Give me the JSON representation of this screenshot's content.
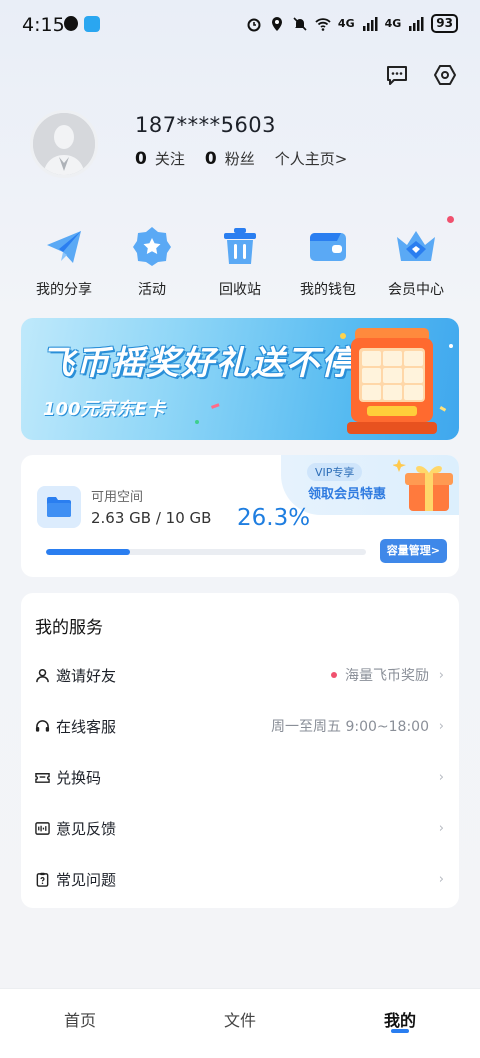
{
  "status_bar": {
    "time": "4:15",
    "battery": "93",
    "net1": "4G",
    "net2": "4G"
  },
  "header": {
    "message_icon": "message-icon",
    "settings_icon": "settings-hex-icon"
  },
  "profile": {
    "username": "187****5603",
    "following_count": "0",
    "following_label": "关注",
    "followers_count": "0",
    "followers_label": "粉丝",
    "home_link": "个人主页>"
  },
  "quick_actions": [
    {
      "label": "我的分享",
      "icon": "paper-plane-icon"
    },
    {
      "label": "活动",
      "icon": "star-badge-icon"
    },
    {
      "label": "回收站",
      "icon": "trash-icon"
    },
    {
      "label": "我的钱包",
      "icon": "wallet-icon"
    },
    {
      "label": "会员中心",
      "icon": "crown-icon"
    }
  ],
  "banner": {
    "title": "飞币摇奖好礼送不停",
    "subtitle": "100元京东E卡"
  },
  "storage": {
    "label": "可用空间",
    "used": "2.63 GB / 10 GB",
    "percent_text": "26.3%",
    "percent": 26.3,
    "vip_tag": "VIP专享",
    "vip_text": "领取会员特惠",
    "manage_button": "容量管理>"
  },
  "services": {
    "title": "我的服务",
    "items": [
      {
        "label": "邀请好友",
        "value": "海量飞币奖励",
        "icon": "user-icon",
        "has_dot": true
      },
      {
        "label": "在线客服",
        "value": "周一至周五 9:00~18:00",
        "icon": "headset-icon",
        "has_dot": false
      },
      {
        "label": "兑换码",
        "value": "",
        "icon": "ticket-icon",
        "has_dot": false
      },
      {
        "label": "意见反馈",
        "value": "",
        "icon": "feedback-icon",
        "has_dot": false
      },
      {
        "label": "常见问题",
        "value": "",
        "icon": "faq-icon",
        "has_dot": false
      }
    ],
    "chevron": "›"
  },
  "tabbar": {
    "tabs": [
      {
        "label": "首页"
      },
      {
        "label": "文件"
      },
      {
        "label": "我的"
      }
    ],
    "active": 2
  },
  "colors": {
    "accent": "#2a7ef0",
    "red_dot": "#f0516e"
  }
}
